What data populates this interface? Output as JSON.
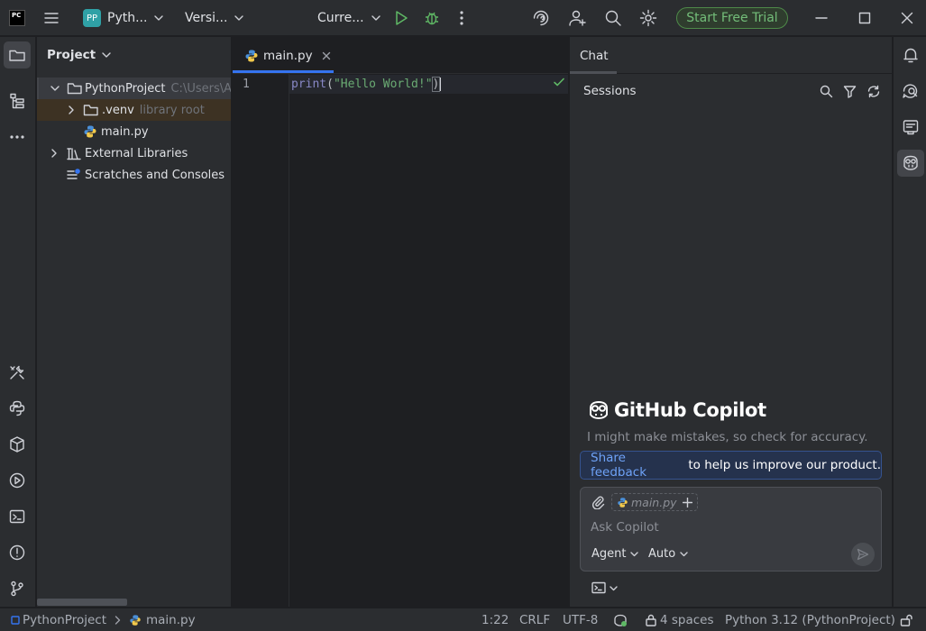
{
  "titlebar": {
    "app_logo_text": "PC",
    "project_badge": "PP",
    "project_name": "Pyth...",
    "vcs_label": "Versi...",
    "run_config": "Curre...",
    "trial_button": "Start Free Trial"
  },
  "project_panel": {
    "title": "Project",
    "tree": [
      {
        "label": "PythonProject",
        "hint": "C:\\Users\\A"
      },
      {
        "label": ".venv",
        "hint": "library root"
      },
      {
        "label": "main.py",
        "hint": ""
      },
      {
        "label": "External Libraries",
        "hint": ""
      },
      {
        "label": "Scratches and Consoles",
        "hint": ""
      }
    ]
  },
  "editor": {
    "tab_label": "main.py",
    "line_number": "1",
    "code": {
      "func": "print",
      "open": "(",
      "string": "\"Hello World!\"",
      "close": ")"
    }
  },
  "chat": {
    "tab_label": "Chat",
    "sessions_label": "Sessions",
    "brand": "GitHub Copilot",
    "disclaimer": "I might make mistakes, so check for accuracy.",
    "feedback_link": "Share feedback",
    "feedback_rest": " to help us improve our product.",
    "context_file": "main.py",
    "input_placeholder": "Ask Copilot",
    "mode_label": "Agent",
    "model_label": "Auto"
  },
  "statusbar": {
    "project": "PythonProject",
    "file": "main.py",
    "position": "1:22",
    "line_ending": "CRLF",
    "encoding": "UTF-8",
    "indent": "4 spaces",
    "interpreter": "Python 3.12 (PythonProject)"
  },
  "colors": {
    "accent": "#3574f0",
    "trial_green": "#73bd79",
    "string_green": "#6aab73",
    "background": "#1e1f22",
    "panel": "#2b2d30"
  }
}
